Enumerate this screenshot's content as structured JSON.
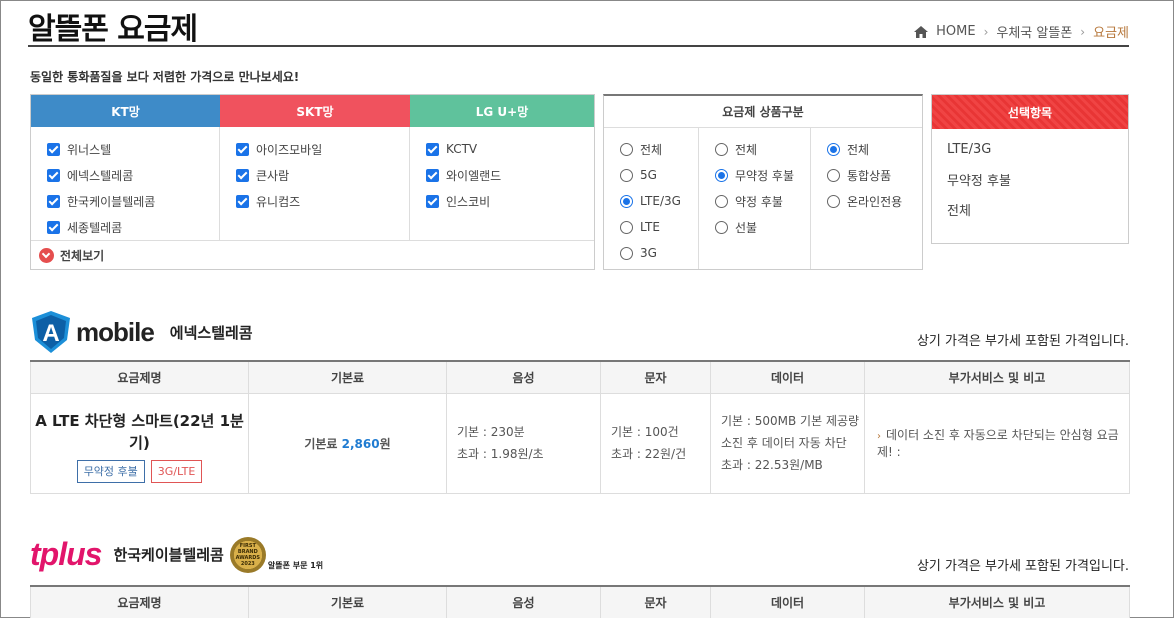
{
  "header": {
    "title": "알뜰폰 요금제",
    "breadcrumb": [
      "HOME",
      "우체국 알뜰폰",
      "요금제"
    ]
  },
  "subtitle": "동일한 통화품질을 보다 저렴한 가격으로 만나보세요!",
  "carriers": {
    "kt": {
      "label": "KT망",
      "items": [
        "위너스텔",
        "에넥스텔레콤",
        "한국케이블텔레콤",
        "세종텔레콤"
      ]
    },
    "skt": {
      "label": "SKT망",
      "items": [
        "아이즈모바일",
        "큰사람",
        "유니컴즈"
      ]
    },
    "lgu": {
      "label": "LG U+망",
      "items": [
        "KCTV",
        "와이엘랜드",
        "인스코비"
      ]
    },
    "view_all": "전체보기"
  },
  "plan_type": {
    "title": "요금제 상품구분",
    "col1": [
      "전체",
      "5G",
      "LTE/3G",
      "LTE",
      "3G"
    ],
    "col2": [
      "전체",
      "무약정 후불",
      "약정 후불",
      "선불"
    ],
    "col3": [
      "전체",
      "통합상품",
      "온라인전용"
    ],
    "selected": {
      "col1": "LTE/3G",
      "col2": "무약정 후불",
      "col3": "전체"
    }
  },
  "selection": {
    "title": "선택항목",
    "items": [
      "LTE/3G",
      "무약정 후불",
      "전체"
    ]
  },
  "table_headers": [
    "요금제명",
    "기본료",
    "음성",
    "문자",
    "데이터",
    "부가서비스 및 비고"
  ],
  "providers": [
    {
      "logo_text": "mobile",
      "logo_letter": "A",
      "name": "에넥스텔레콤",
      "vat_note": "상기 가격은 부가세 포함된 가격입니다.",
      "plan": {
        "name": "A LTE 차단형 스마트(22년 1분기)",
        "tags": [
          "무약정 후불",
          "3G/LTE"
        ],
        "fee_label": "기본료 ",
        "fee_value": "2,860",
        "fee_unit": "원",
        "voice": [
          "기본 : 230분",
          "초과 : 1.98원/초"
        ],
        "sms": [
          "기본 : 100건",
          "초과 : 22원/건"
        ],
        "data": [
          "기본 : 500MB 기본 제공량",
          "소진 후 데이터 자동 차단",
          "초과 : 22.53원/MB"
        ],
        "note": "데이터 소진 후 자동으로 차단되는 안심형 요금제! :"
      }
    },
    {
      "logo_text": "tplus",
      "name": "한국케이블텔레콤",
      "award_badge": "FIRST BRAND AWARDS 2023",
      "award_text": "알뜰폰 부문 1위",
      "vat_note": "상기 가격은 부가세 포함된 가격입니다."
    }
  ],
  "colors": {
    "kt": "#3e8bc8",
    "skt": "#f0525e",
    "lgu": "#5fc29c",
    "accent": "#1f7bd1",
    "selection": "#f04444"
  }
}
